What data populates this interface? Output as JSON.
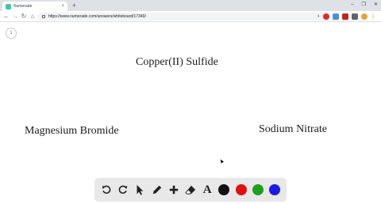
{
  "browser": {
    "tab_title": "Numerade",
    "tab_close": "×",
    "new_tab": "+",
    "window_controls": [
      "–",
      "❐",
      "✕"
    ],
    "back": "←",
    "forward": "→",
    "reload": "↻",
    "home": "⌂",
    "url": "https://www.numerade.com/answers/whiteboard/17349/",
    "omnibox_icons": [
      "◑",
      "☆"
    ],
    "menu": "⋮"
  },
  "whiteboard": {
    "page_number": "1",
    "texts": {
      "top": "Copper(II) Sulfide",
      "left": "Magnesium Bromide",
      "right": "Sodium Nitrate"
    }
  },
  "palette": {
    "tools": [
      "undo-icon",
      "redo-icon",
      "select-pointer-icon",
      "pen-icon",
      "add-icon",
      "eraser-icon",
      "text-icon"
    ],
    "text_tool_label": "A",
    "colors": [
      "#111111",
      "#e01010",
      "#1ea01e",
      "#1a1ae6"
    ]
  }
}
